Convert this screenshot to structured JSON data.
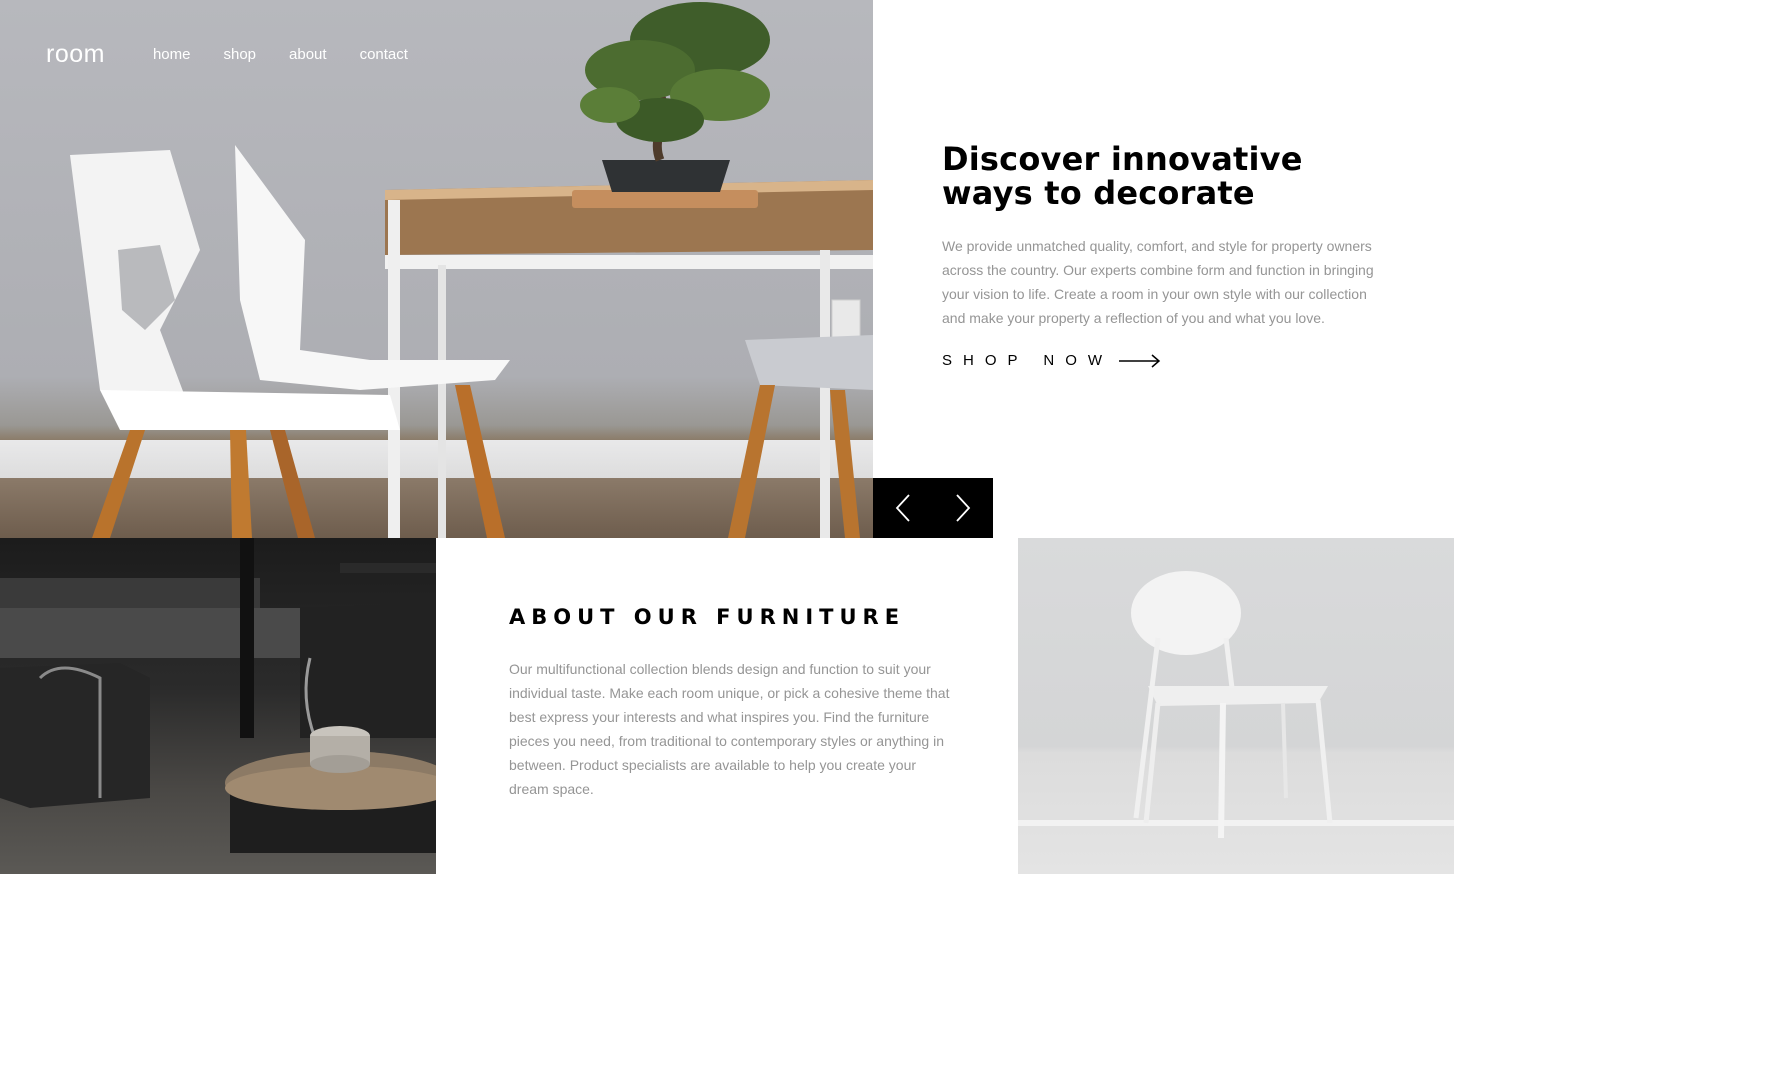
{
  "brand": {
    "logo": "room"
  },
  "nav": {
    "items": [
      {
        "label": "home"
      },
      {
        "label": "shop"
      },
      {
        "label": "about"
      },
      {
        "label": "contact"
      }
    ]
  },
  "hero": {
    "title": "Discover innovative ways to decorate",
    "body": "We provide unmatched quality, comfort, and style for property owners across the country. Our experts combine form and function in bringing your vision to life. Create a room in your own style with our collection and make your property a reflection of you and what you love.",
    "cta_label": "SHOP NOW",
    "cta_icon": "arrow-right-icon"
  },
  "slider": {
    "prev_icon": "chevron-left-icon",
    "next_icon": "chevron-right-icon"
  },
  "about": {
    "title": "ABOUT OUR FURNITURE",
    "body": "Our multifunctional collection blends design and function to suit your individual taste. Make each room unique, or pick a cohesive theme that best express your interests and what inspires you. Find the furniture pieces you need, from traditional to contemporary styles or anything in between. Product specialists are available to help you create your dream space."
  },
  "colors": {
    "text_primary": "#000000",
    "text_muted": "#959595",
    "slider_bg": "#000000",
    "nav_text": "#ffffff"
  }
}
